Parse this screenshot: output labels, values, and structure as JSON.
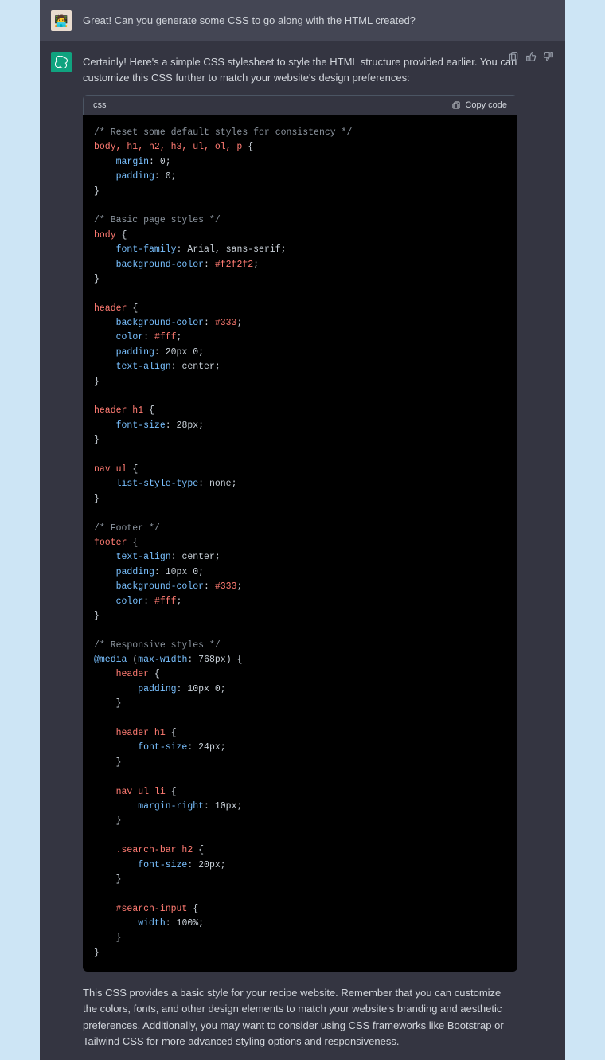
{
  "user": {
    "text": "Great! Can you generate some CSS to go along with the HTML created?"
  },
  "assistant": {
    "intro": "Certainly! Here's a simple CSS stylesheet to style the HTML structure provided earlier. You can customize this CSS further to match your website's design preferences:",
    "code_lang": "css",
    "copy_label": "Copy code",
    "outro": "This CSS provides a basic style for your recipe website. Remember that you can customize the colors, fonts, and other design elements to match your website's branding and aesthetic preferences. Additionally, you may want to consider using CSS frameworks like Bootstrap or Tailwind CSS for more advanced styling options and responsiveness."
  },
  "code": {
    "comment_reset": "/* Reset some default styles for consistency */",
    "sel_reset": "body, h1, h2, h3, ul, ol, p",
    "prop_margin": "margin",
    "val_zero": "0",
    "prop_padding": "padding",
    "comment_basic": "/* Basic page styles */",
    "sel_body": "body",
    "prop_fontfamily": "font-family",
    "val_fontfamily": "Arial, sans-serif",
    "prop_bgcolor": "background-color",
    "val_bg_f2": "#f2f2f2",
    "sel_header": "header",
    "val_color_333": "#333",
    "prop_color": "color",
    "val_color_fff": "#fff",
    "val_20px0": "20px 0",
    "prop_textalign": "text-align",
    "val_center": "center",
    "sel_header_h1": "header h1",
    "prop_fontsize": "font-size",
    "val_28px": "28px",
    "sel_nav_ul": "nav ul",
    "prop_liststyle": "list-style-type",
    "val_none": "none",
    "comment_footer": "/* Footer */",
    "sel_footer": "footer",
    "val_10px0": "10px 0",
    "comment_responsive": "/* Responsive styles */",
    "at_media": "@media",
    "fn_maxwidth": "max-width",
    "val_768px": "768px",
    "sel_nav_ul_li": "nav ul li",
    "prop_marginright": "margin-right",
    "val_10px": "10px",
    "sel_searchbar_h2": ".search-bar h2",
    "val_20px": "20px",
    "sel_searchinput": "#search-input",
    "prop_width": "width",
    "val_100pct": "100%",
    "val_24px": "24px"
  }
}
